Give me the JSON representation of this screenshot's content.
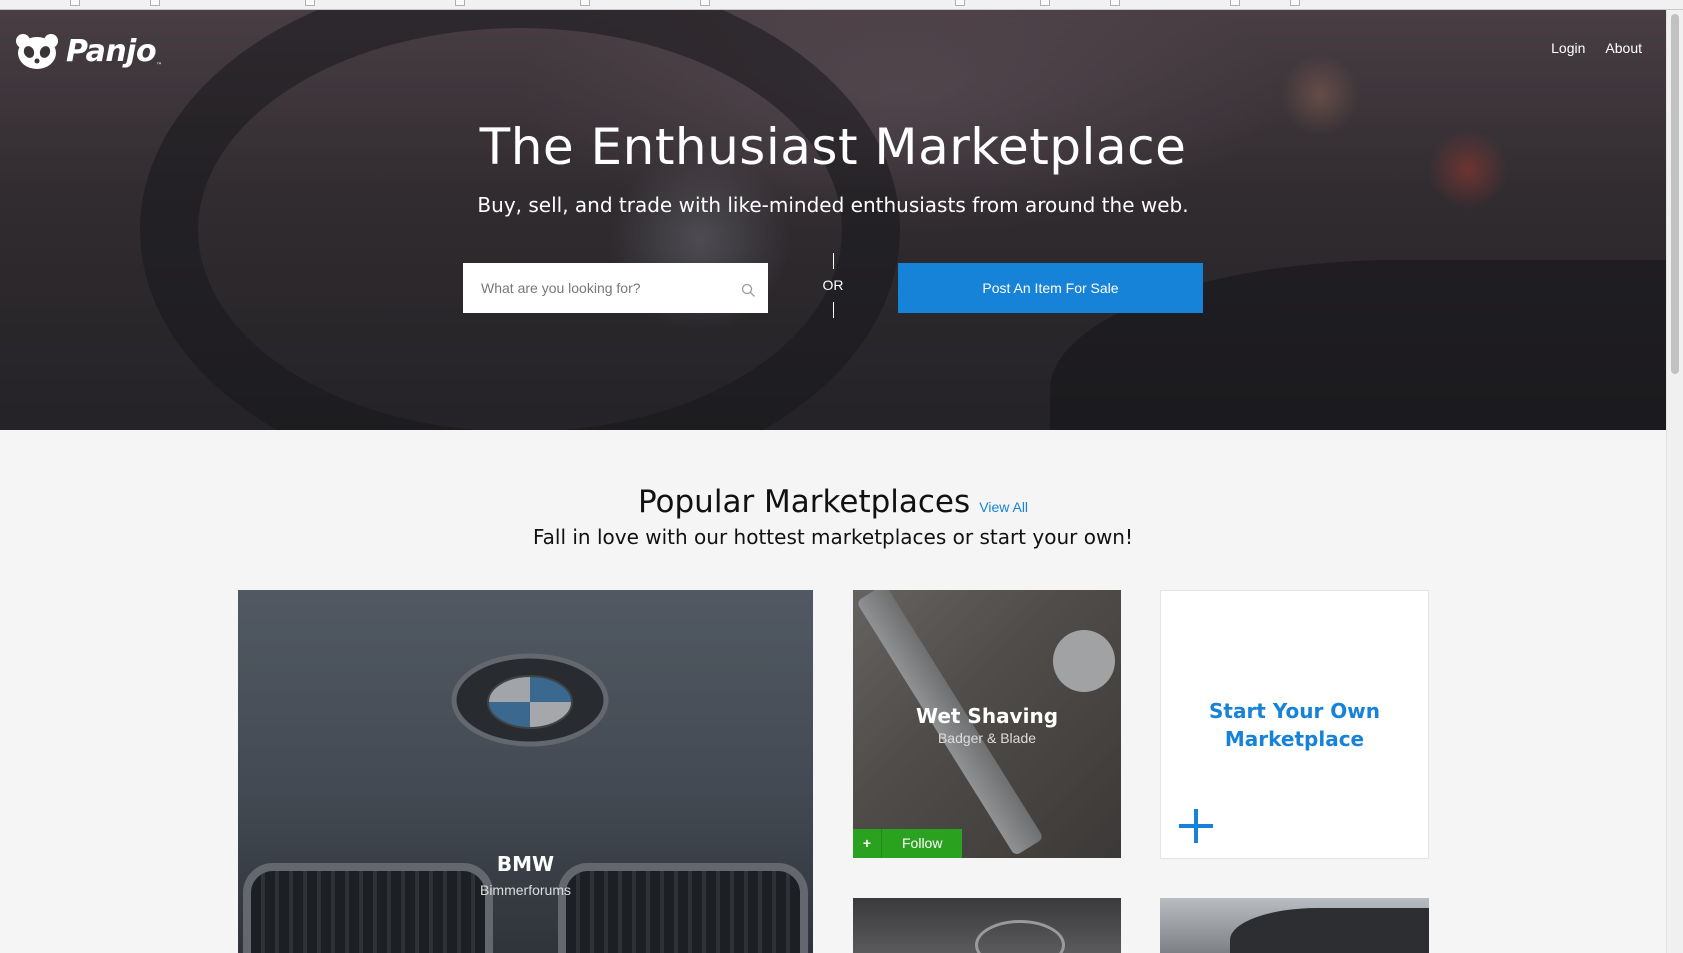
{
  "header": {
    "brand": "Panjo",
    "trademark": "™",
    "nav": [
      {
        "label": "Login"
      },
      {
        "label": "About"
      }
    ]
  },
  "hero": {
    "title": "The Enthusiast Marketplace",
    "subtitle": "Buy, sell, and trade with like-minded enthusiasts from around the web.",
    "search": {
      "placeholder": "What are you looking for?",
      "value": ""
    },
    "or_label": "OR",
    "post_button": "Post An Item For Sale"
  },
  "marketplaces": {
    "title": "Popular Marketplaces",
    "view_all": "View All",
    "subtitle": "Fall in love with our hottest marketplaces or start your own!",
    "cards": [
      {
        "title": "BMW",
        "subtitle": "Bimmerforums"
      },
      {
        "title": "Wet Shaving",
        "subtitle": "Badger & Blade",
        "follow_plus": "+",
        "follow_label": "Follow"
      }
    ],
    "start_own": {
      "line1": "Start Your Own",
      "line2": "Marketplace"
    }
  },
  "colors": {
    "accent": "#1683d8",
    "follow_green": "#2aa21f",
    "background": "#f5f5f5"
  }
}
